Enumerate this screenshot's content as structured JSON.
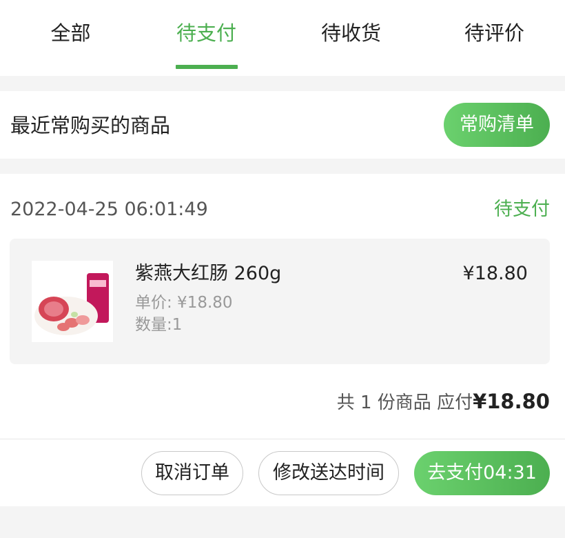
{
  "tabs": [
    {
      "label": "全部"
    },
    {
      "label": "待支付",
      "active": true
    },
    {
      "label": "待收货"
    },
    {
      "label": "待评价"
    }
  ],
  "recent": {
    "title": "最近常购买的商品",
    "button": "常购清单"
  },
  "order": {
    "datetime": "2022-04-25 06:01:49",
    "status": "待支付",
    "item": {
      "name": "紫燕大红肠 260g",
      "price": "¥18.80",
      "unit_price": "单价: ¥18.80",
      "quantity": "数量:1"
    },
    "summary_prefix": "共 1 份商品  应付",
    "summary_total": "¥18.80",
    "actions": {
      "cancel": "取消订单",
      "modify_time": "修改送达时间",
      "pay": "去支付04:31"
    }
  },
  "colors": {
    "accent": "#4caf50",
    "background": "#f4f4f4"
  }
}
